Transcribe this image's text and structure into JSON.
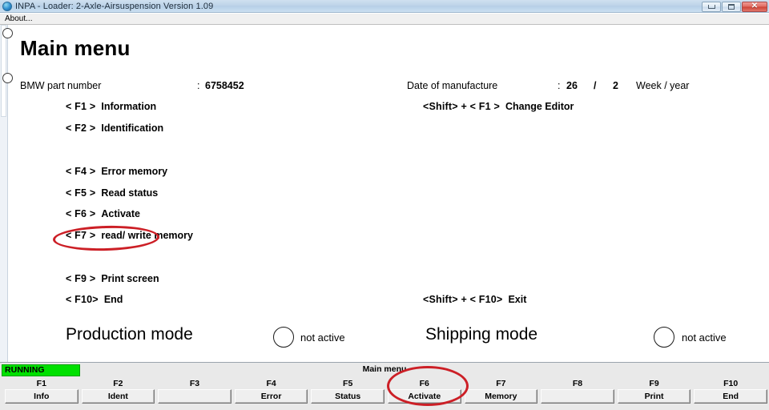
{
  "window": {
    "title": "INPA - Loader:  2-Axle-Airsuspension Version 1.09",
    "icon": "inpa-globe-icon",
    "minimize_label": "–",
    "maximize_label": "□",
    "close_label": "✕"
  },
  "menubar": {
    "items": [
      {
        "label": "About..."
      }
    ]
  },
  "content": {
    "page_title": "Main menu",
    "part_number": {
      "label": "BMW part number",
      "separator": ":",
      "value": "6758452"
    },
    "date_of_manufacture": {
      "label": "Date of manufacture",
      "separator": ":",
      "week": "26",
      "slash": "/",
      "year": "2",
      "unit_label": "Week / year"
    },
    "menu_items_left": [
      {
        "key": "< F1 >",
        "label": "Information"
      },
      {
        "key": "< F2 >",
        "label": "Identification"
      },
      {
        "key": "< F4 >",
        "label": "Error memory"
      },
      {
        "key": "< F5 >",
        "label": "Read status"
      },
      {
        "key": "< F6 >",
        "label": "Activate"
      },
      {
        "key": "< F7 >",
        "label": "read/ write memory"
      },
      {
        "key": "< F9 >",
        "label": "Print screen"
      },
      {
        "key": "< F10>",
        "label": "End"
      }
    ],
    "menu_items_right": [
      {
        "key": "<Shift> + < F1 >",
        "label": "Change Editor"
      },
      {
        "key": "<Shift> + < F10>",
        "label": "Exit"
      }
    ],
    "modes": [
      {
        "title": "Production mode",
        "status": "not active",
        "indicator": "off"
      },
      {
        "title": "Shipping mode",
        "status": "not active",
        "indicator": "off"
      }
    ],
    "annotation_color": "#cc1f26"
  },
  "statusbar": {
    "run_state": "RUNNING",
    "run_state_color": "#00e000",
    "center_label": "Main menu",
    "function_keys": [
      {
        "name": "F1",
        "label": "Info"
      },
      {
        "name": "F2",
        "label": "Ident"
      },
      {
        "name": "F3",
        "label": ""
      },
      {
        "name": "F4",
        "label": "Error"
      },
      {
        "name": "F5",
        "label": "Status"
      },
      {
        "name": "F6",
        "label": "Activate"
      },
      {
        "name": "F7",
        "label": "Memory"
      },
      {
        "name": "F8",
        "label": ""
      },
      {
        "name": "F9",
        "label": "Print"
      },
      {
        "name": "F10",
        "label": "End"
      }
    ]
  }
}
